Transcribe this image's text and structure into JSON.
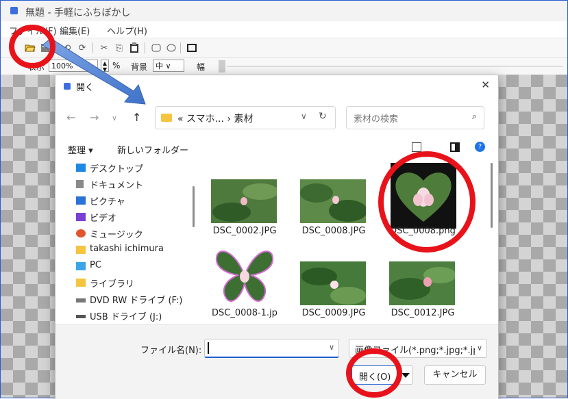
{
  "app": {
    "title": "無題 - 手軽にふちぼかし",
    "menu": [
      "ファイル(F)",
      "編集(E)",
      "ヘルプ(H)"
    ],
    "toolbar_icons": [
      "open-folder-icon",
      "save-icon",
      "undo-icon",
      "redo-icon",
      "cut-icon",
      "copy-icon",
      "paste-icon",
      "rounded-rect-icon",
      "ellipse-icon",
      "rect-icon"
    ],
    "zoom_label": "表示",
    "zoom_value": "100%",
    "percent_label": "%",
    "background_label": "背景",
    "background_value": "中",
    "width_label": "幅"
  },
  "dialog": {
    "title": "開く",
    "close": "✕",
    "address": "« スマホ... › 素材",
    "search_placeholder": "素材の検索",
    "organize": "整理 ▾",
    "new_folder": "新しいフォルダー",
    "help": "?",
    "nav_items": [
      {
        "label": "デスクトップ",
        "icon": "desktop-icon",
        "color": "#1e88e5"
      },
      {
        "label": "ドキュメント",
        "icon": "document-icon",
        "color": "#8a8a8a"
      },
      {
        "label": "ピクチャ",
        "icon": "pictures-icon",
        "color": "#2a72d6"
      },
      {
        "label": "ビデオ",
        "icon": "video-icon",
        "color": "#7b3fd6"
      },
      {
        "label": "ミュージック",
        "icon": "music-icon",
        "color": "#e0552c"
      },
      {
        "label": "takashi ichimura",
        "icon": "user-folder-icon",
        "color": "#f5c542"
      },
      {
        "label": "PC",
        "icon": "pc-icon",
        "color": "#3aa6e8"
      },
      {
        "label": "ライブラリ",
        "icon": "library-icon",
        "color": "#f5c542"
      },
      {
        "label": "DVD RW ドライブ (F:)",
        "icon": "dvd-drive-icon",
        "color": "#777777"
      },
      {
        "label": "USB ドライブ (J:)",
        "icon": "usb-drive-icon",
        "color": "#555555"
      }
    ],
    "files": [
      {
        "name": "DSC_0002.JPG",
        "thumb": "lotus-photo"
      },
      {
        "name": "DSC_0008.JPG",
        "thumb": "lotus-photo"
      },
      {
        "name": "DSC_0008.png",
        "thumb": "heart-lotus"
      },
      {
        "name": "DSC_0008-1.jp",
        "thumb": "butterfly-lotus"
      },
      {
        "name": "DSC_0009.JPG",
        "thumb": "lotus-photo"
      },
      {
        "name": "DSC_0012.JPG",
        "thumb": "lotus-photo"
      }
    ],
    "filename_label": "ファイル名(N):",
    "filename_value": "",
    "filetype": "画像ファイル(*.png;*.jpg;*.jp",
    "open_button": "開く(O)",
    "cancel_button": "キャンセル"
  },
  "annotations": {
    "circle_color": "#e8131a",
    "arrow_color": "#4a7fd0"
  }
}
